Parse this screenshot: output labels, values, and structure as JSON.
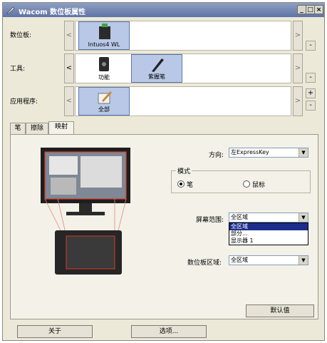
{
  "window": {
    "title": "Wacom 数位板属性"
  },
  "rows": {
    "tablet": {
      "label": "数位板:",
      "items": [
        {
          "label": "Intuos4 WL"
        }
      ]
    },
    "tool": {
      "label": "工具:",
      "items": [
        {
          "label": "功能"
        },
        {
          "label": "紫握笔"
        }
      ]
    },
    "app": {
      "label": "应用程序:",
      "items": [
        {
          "label": "全部"
        }
      ]
    }
  },
  "tabs": [
    {
      "label": "笔"
    },
    {
      "label": "擦除"
    },
    {
      "label": "映射"
    }
  ],
  "mapping": {
    "orientation_label": "方向:",
    "orientation_value": "左ExpressKey",
    "mode_label": "模式",
    "mode_pen": "笔",
    "mode_mouse": "鼠标",
    "screen_area_label": "屏幕范围:",
    "screen_area_value": "全区域",
    "screen_area_options": [
      "全区域",
      "部分...",
      "显示器 1"
    ],
    "tablet_area_label": "数位板区域:",
    "tablet_area_value": "全区域",
    "default_button": "默认值"
  },
  "footer": {
    "about_button": "关于",
    "options_button": "选项..."
  },
  "colors": {
    "selection": "#b9c8e6",
    "dropdown_highlight": "#1c2d8c",
    "title_bar": "#5f73a6"
  }
}
